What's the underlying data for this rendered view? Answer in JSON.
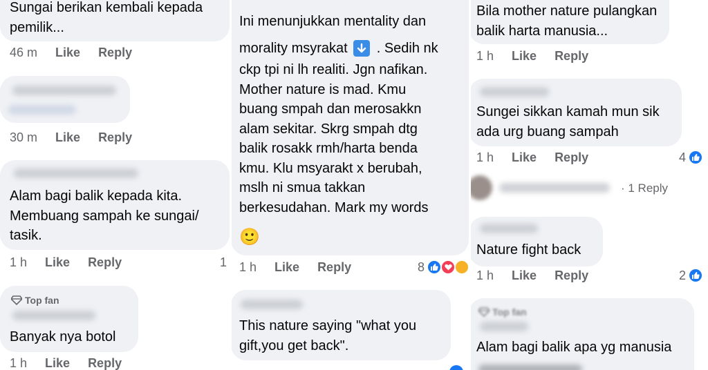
{
  "col1": {
    "c1": {
      "text": "Sungai berikan kembali kepada\npemilik...",
      "time": "46 m"
    },
    "c2": {
      "time": "30 m"
    },
    "c3": {
      "text": "Alam bagi balik kepada kita.\nMembuang sampah ke sungai/\ntasik.",
      "time": "1 h",
      "count": "1"
    },
    "c4": {
      "badge": "Top fan",
      "text": "Banyak nya botol",
      "time": "1 h"
    }
  },
  "col2": {
    "c1": {
      "text_line1": "Ini menunjukkan mentality dan",
      "text_line2a": "morality msyrakat",
      "text_line2b": ". Sedih nk",
      "text_rest": "ckp tpi ni lh realiti. Jgn nafikan.\nMother nature is mad. Kmu\nbuang smpah dan merosakkn\nalam sekitar. Skrg smpah dtg\nbalik rosakk rmh/harta benda\nkmu. Klu msyarakt x berubah,\nmslh ni smua takkan\nberkesudahan. Mark my words",
      "emoji": "🙂",
      "time": "1 h",
      "count": "8"
    },
    "c2": {
      "text": "This nature saying \"what you\ngift,you get back\"."
    }
  },
  "col3": {
    "c1": {
      "text": "Bila mother nature pulangkan\nbalik harta manusia...",
      "time": "1 h"
    },
    "c2": {
      "text": "Sungei sikkan kamah mun sik\nada urg buang sampah",
      "time": "1 h",
      "count": "4"
    },
    "reply_link": "· 1 Reply",
    "c3": {
      "text": "Nature fight back",
      "time": "1 h",
      "count": "2"
    },
    "c4": {
      "badge": "Top fan",
      "text": "Alam bagi balik apa yg manusia"
    }
  },
  "labels": {
    "like": "Like",
    "reply": "Reply"
  },
  "colors": {
    "bubble": "#eff1f4",
    "meta": "#65676b",
    "like_blue": "#1877f2",
    "love_red": "#f33e58"
  }
}
